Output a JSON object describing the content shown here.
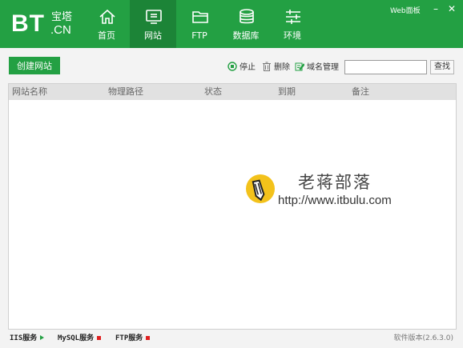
{
  "app": {
    "logo_main": "BT",
    "logo_cn_top": "宝塔",
    "logo_cn_bottom": ".CN",
    "web_panel": "Web面板",
    "minimize": "–",
    "close": "✕"
  },
  "nav": {
    "items": [
      {
        "label": "首页",
        "icon": "home-icon"
      },
      {
        "label": "网站",
        "icon": "monitor-icon"
      },
      {
        "label": "FTP",
        "icon": "folder-icon"
      },
      {
        "label": "数据库",
        "icon": "database-icon"
      },
      {
        "label": "环境",
        "icon": "sliders-icon"
      }
    ],
    "active": "网站"
  },
  "toolbar": {
    "create_label": "创建网站",
    "stop_label": "停止",
    "delete_label": "删除",
    "domain_label": "域名管理",
    "search_value": "",
    "search_button": "查找"
  },
  "table": {
    "columns": [
      "网站名称",
      "物理路径",
      "状态",
      "到期",
      "备注"
    ],
    "rows": []
  },
  "watermark": {
    "title": "老蒋部落",
    "url": "http://www.itbulu.com"
  },
  "statusbar": {
    "services": [
      {
        "label": "IIS服务",
        "state": "running",
        "color": "#23a043"
      },
      {
        "label": "MySQL服务",
        "state": "stopped",
        "color": "#e02020"
      },
      {
        "label": "FTP服务",
        "state": "stopped",
        "color": "#e02020"
      }
    ],
    "version": "软件版本(2.6.3.0)"
  },
  "colors": {
    "brand_green": "#23a043",
    "active_tab": "#1c8437",
    "stopped": "#e02020"
  }
}
